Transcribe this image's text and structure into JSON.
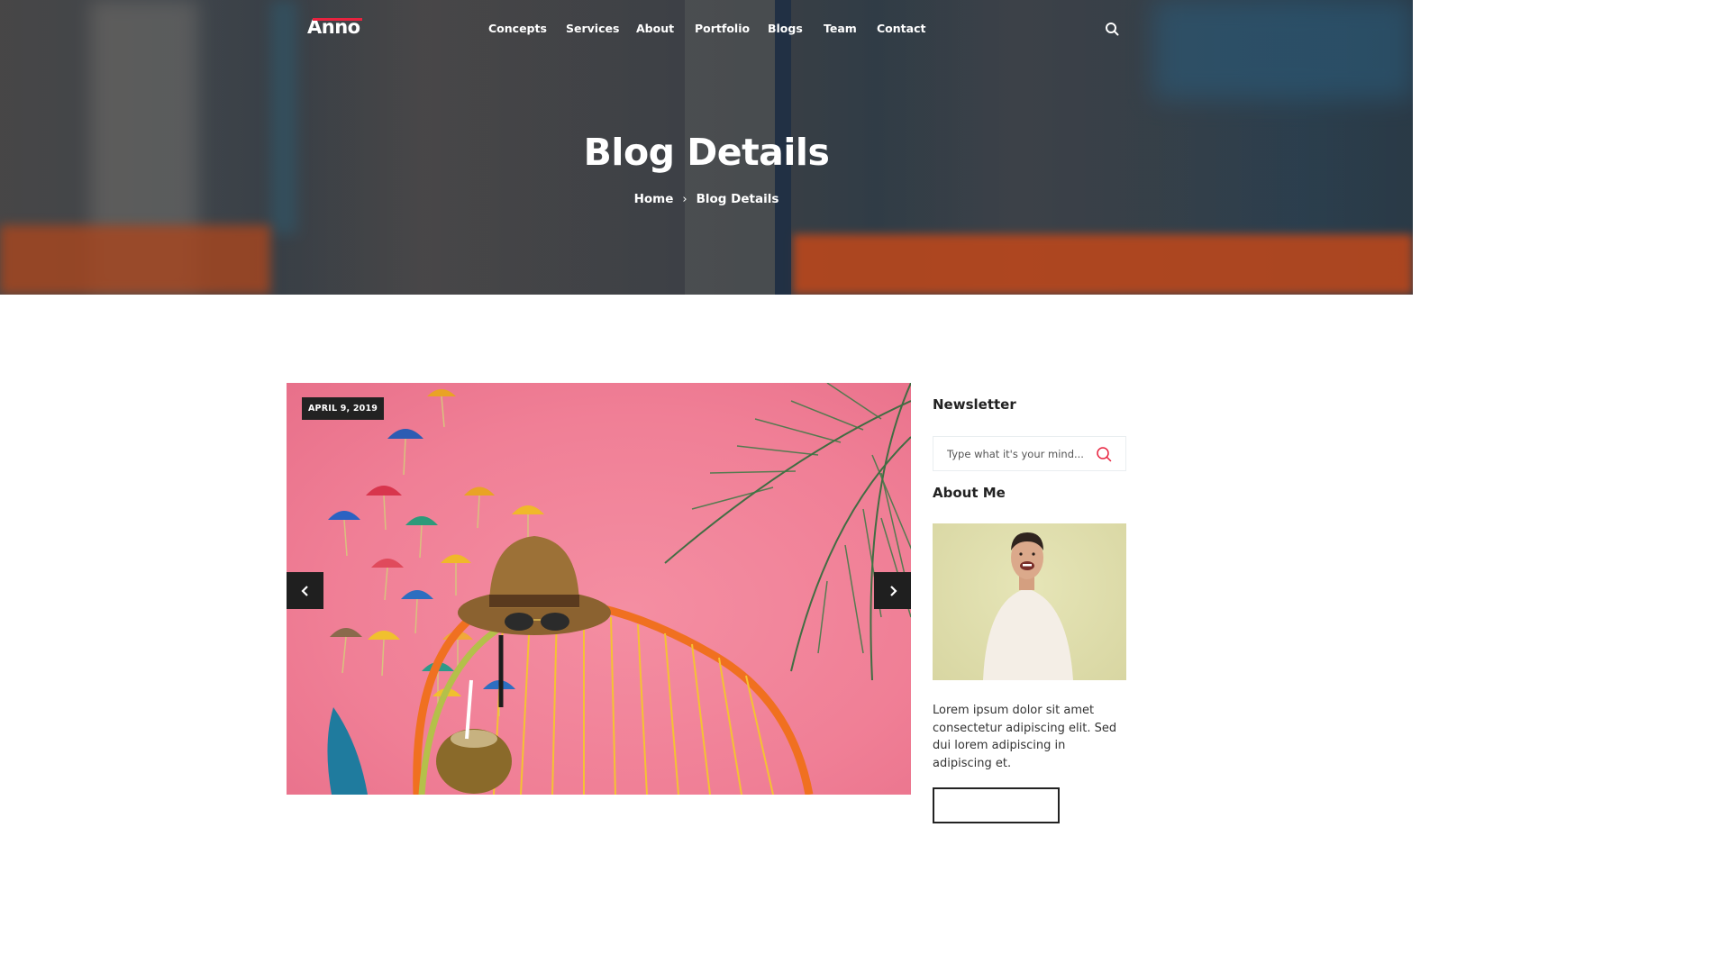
{
  "header": {
    "logo_text": "Anno",
    "nav": [
      "Concepts",
      "Services",
      "About",
      "Portfolio",
      "Blogs",
      "Team",
      "Contact"
    ],
    "search_icon": "search-icon"
  },
  "hero": {
    "title": "Blog Details",
    "breadcrumb": {
      "home": "Home",
      "separator": "›",
      "current": "Blog Details"
    }
  },
  "post": {
    "date": "APRIL 9, 2019",
    "prev_icon": "chevron-left-icon",
    "next_icon": "chevron-right-icon"
  },
  "sidebar": {
    "newsletter_title": "Newsletter",
    "newsletter_placeholder": "Type what it's your mind...",
    "about_title": "About Me",
    "about_text": "Lorem ipsum dolor sit amet consectetur adipiscing elit. Sed dui lorem adipiscing in adipiscing et."
  },
  "colors": {
    "accent": "#e8233f",
    "dark": "#222222",
    "hero_overlay": "#2a2a2e"
  }
}
